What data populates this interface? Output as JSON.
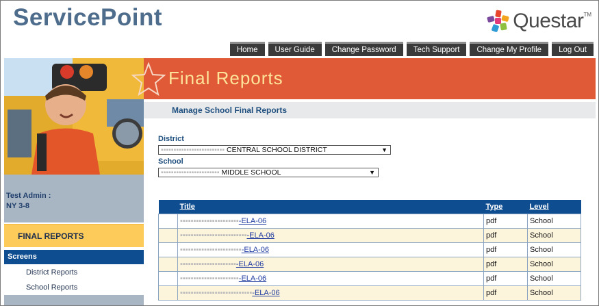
{
  "brand": {
    "title": "ServicePoint",
    "logo_text": "Questar",
    "logo_tm": "TM"
  },
  "nav": [
    "Home",
    "User Guide",
    "Change Password",
    "Tech Support",
    "Change My Profile",
    "Log Out"
  ],
  "user": {
    "role_label": "Test Admin :",
    "test_name": "NY 3-8"
  },
  "sidebar": {
    "heading": "FINAL REPORTS",
    "section_label": "Screens",
    "links": [
      "District Reports",
      "School Reports"
    ]
  },
  "banner": {
    "title": "Final Reports"
  },
  "subheader": "Manage School Final Reports",
  "filters": {
    "district_label": "District",
    "district_value": "CENTRAL SCHOOL DISTRICT",
    "school_label": "School",
    "school_value": "MIDDLE SCHOOL"
  },
  "table": {
    "headers": [
      "Title",
      "Type",
      "Level"
    ],
    "rows": [
      {
        "title": "-ELA-06",
        "type": "pdf",
        "level": "School"
      },
      {
        "title": "-ELA-06",
        "type": "pdf",
        "level": "School"
      },
      {
        "title": "-ELA-06",
        "type": "pdf",
        "level": "School"
      },
      {
        "title": "-ELA-06",
        "type": "pdf",
        "level": "School"
      },
      {
        "title": "-ELA-06",
        "type": "pdf",
        "level": "School"
      },
      {
        "title": "-ELA-06",
        "type": "pdf",
        "level": "School"
      }
    ]
  },
  "colors": {
    "header_blue": "#0e4d8f",
    "banner_orange": "#e05a38",
    "accent_yellow": "#fccb5a",
    "brand_slate": "#4e6c8c"
  }
}
